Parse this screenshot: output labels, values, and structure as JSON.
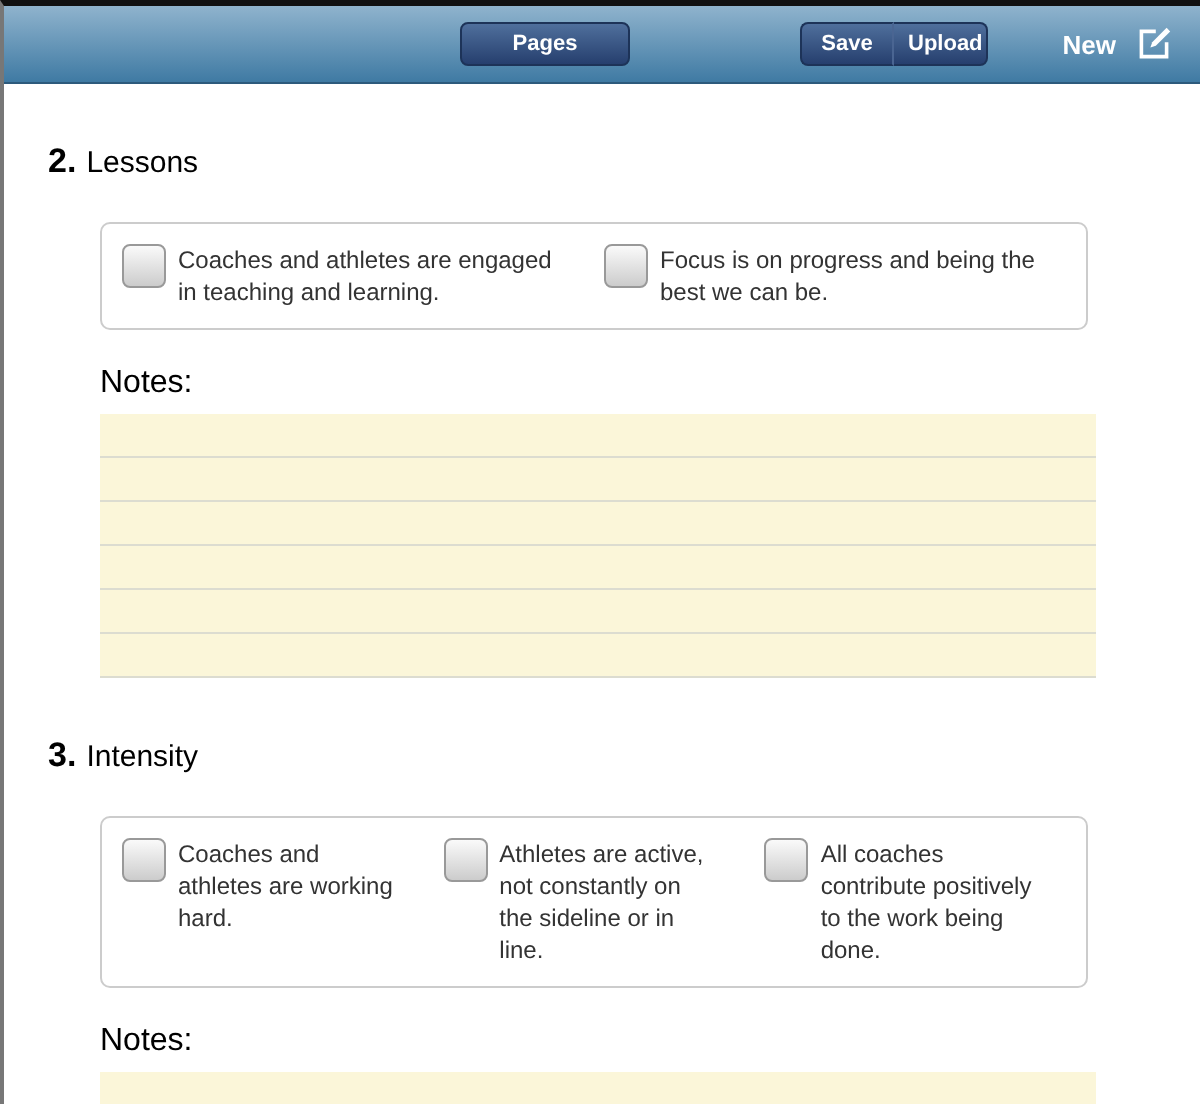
{
  "toolbar": {
    "center_button": "Pages",
    "segmented": [
      {
        "label": "Save"
      },
      {
        "label": "Upload"
      }
    ],
    "new_button": "New"
  },
  "sections": [
    {
      "number": "2.",
      "title": "Lessons",
      "items": [
        {
          "text": "Coaches and athletes are engaged in teaching and learning.",
          "checked": false
        },
        {
          "text": "Focus is on progress and being the best we can be.",
          "checked": false
        }
      ],
      "notes_label": "Notes:"
    },
    {
      "number": "3.",
      "title": "Intensity",
      "items": [
        {
          "text": "Coaches and athletes are working hard.",
          "checked": false
        },
        {
          "text": "Athletes are active, not constantly on the sideline or in line.",
          "checked": false
        },
        {
          "text": "All coaches contribute positively to the work being done.",
          "checked": false
        }
      ],
      "notes_label": "Notes:"
    }
  ]
}
